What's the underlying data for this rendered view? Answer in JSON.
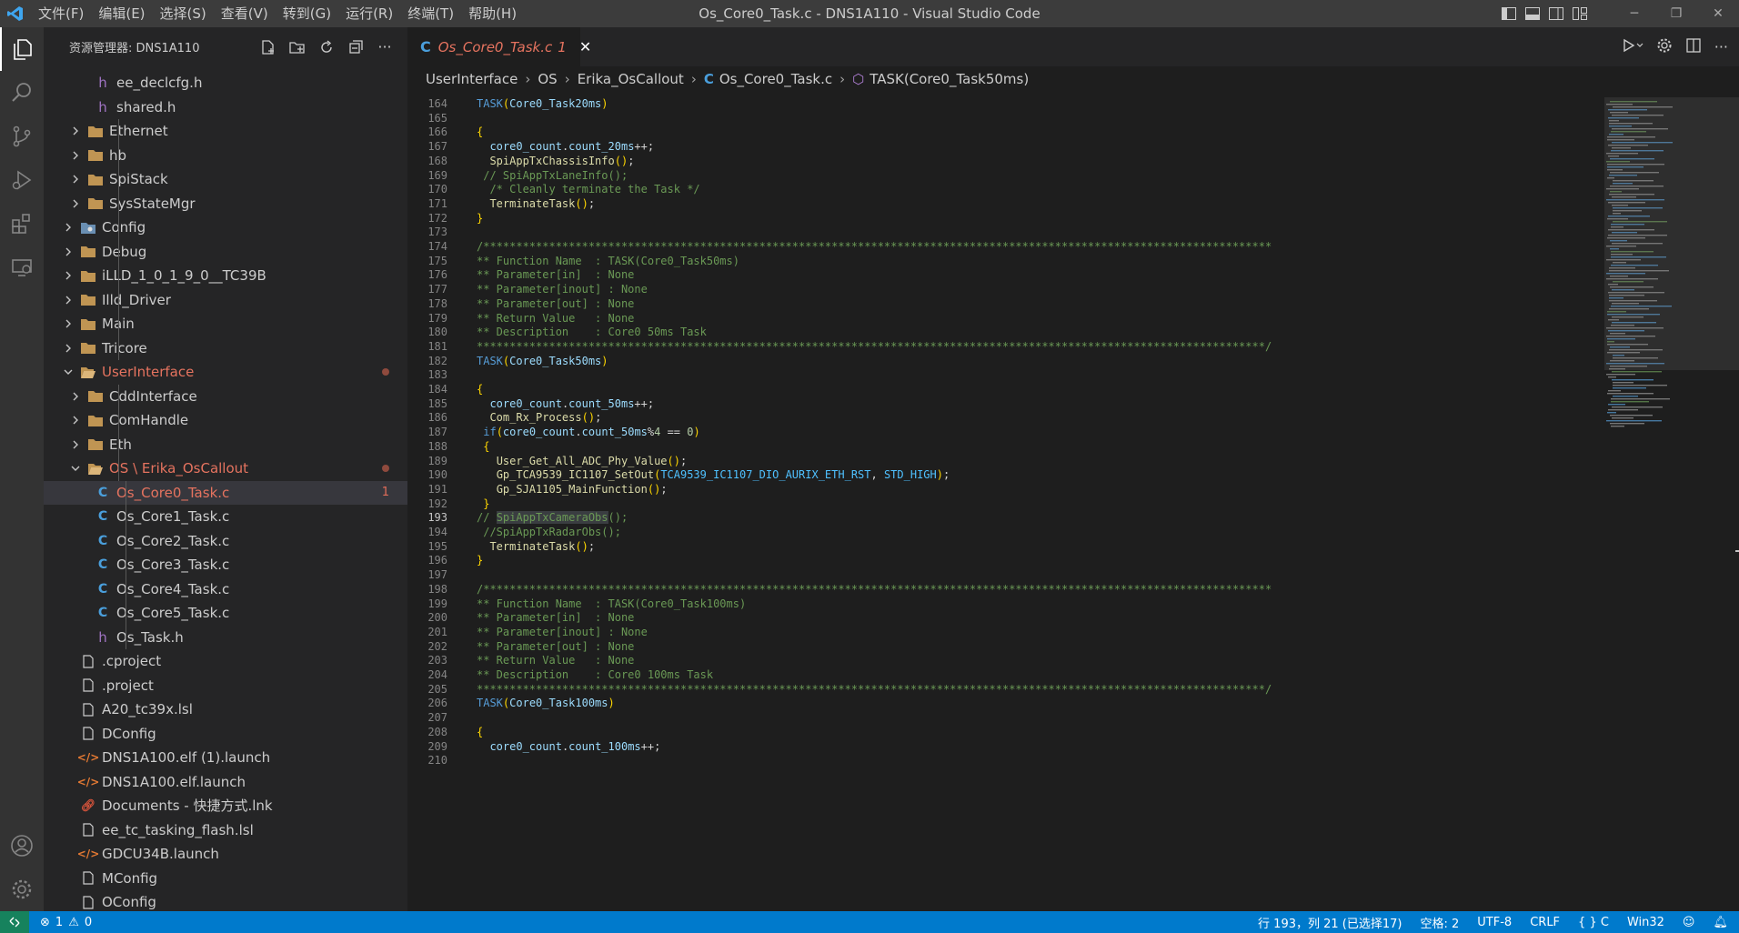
{
  "titlebar": {
    "menus": [
      "文件(F)",
      "编辑(E)",
      "选择(S)",
      "查看(V)",
      "转到(G)",
      "运行(R)",
      "终端(T)",
      "帮助(H)"
    ],
    "window_title": "Os_Core0_Task.c - DNS1A110 - Visual Studio Code"
  },
  "activity": {
    "icons": [
      "explorer-icon",
      "search-icon",
      "source-control-icon",
      "run-debug-icon",
      "extensions-icon",
      "remote-explorer-icon",
      "account-icon",
      "settings-gear-icon"
    ]
  },
  "explorer": {
    "title": "资源管理器: DNS1A110",
    "items": [
      {
        "label": "ee_declcfg.h",
        "kind": "h"
      },
      {
        "label": "shared.h",
        "kind": "h"
      },
      {
        "label": "Ethernet",
        "kind": "folder"
      },
      {
        "label": "hb",
        "kind": "folder"
      },
      {
        "label": "SpiStack",
        "kind": "folder"
      },
      {
        "label": "SysStateMgr",
        "kind": "folder"
      },
      {
        "label": "Config",
        "kind": "folder-config"
      },
      {
        "label": "Debug",
        "kind": "folder"
      },
      {
        "label": "iLLD_1_0_1_9_0__TC39B",
        "kind": "folder"
      },
      {
        "label": "Illd_Driver",
        "kind": "folder"
      },
      {
        "label": "Main",
        "kind": "folder"
      },
      {
        "label": "Tricore",
        "kind": "folder"
      },
      {
        "label": "UserInterface",
        "kind": "folder-open"
      },
      {
        "label": "CddInterface",
        "kind": "folder"
      },
      {
        "label": "ComHandle",
        "kind": "folder"
      },
      {
        "label": "Eth",
        "kind": "folder"
      },
      {
        "label": "OS \\ Erika_OsCallout",
        "kind": "folder-open"
      },
      {
        "label": "Os_Core0_Task.c",
        "kind": "c",
        "badge": "1"
      },
      {
        "label": "Os_Core1_Task.c",
        "kind": "c"
      },
      {
        "label": "Os_Core2_Task.c",
        "kind": "c"
      },
      {
        "label": "Os_Core3_Task.c",
        "kind": "c"
      },
      {
        "label": "Os_Core4_Task.c",
        "kind": "c"
      },
      {
        "label": "Os_Core5_Task.c",
        "kind": "c"
      },
      {
        "label": "Os_Task.h",
        "kind": "h"
      },
      {
        "label": ".cproject",
        "kind": "file"
      },
      {
        "label": ".project",
        "kind": "file"
      },
      {
        "label": "A20_tc39x.lsl",
        "kind": "file"
      },
      {
        "label": "DConfig",
        "kind": "file"
      },
      {
        "label": "DNS1A100.elf (1).launch",
        "kind": "xml"
      },
      {
        "label": "DNS1A100.elf.launch",
        "kind": "xml"
      },
      {
        "label": "Documents - 快捷方式.lnk",
        "kind": "lnk"
      },
      {
        "label": "ee_tc_tasking_flash.lsl",
        "kind": "file"
      },
      {
        "label": "GDCU34B.launch",
        "kind": "xml"
      },
      {
        "label": "MConfig",
        "kind": "file"
      },
      {
        "label": "OConfig",
        "kind": "file"
      }
    ]
  },
  "editor": {
    "tab": {
      "icon": "C",
      "label": "Os_Core0_Task.c",
      "badge": "1",
      "close": "✕"
    },
    "breadcrumb": {
      "parts": [
        "UserInterface",
        "OS",
        "Erika_OsCallout"
      ],
      "file": "Os_Core0_Task.c",
      "symbol": "TASK(Core0_Task50ms)"
    },
    "lines": [
      {
        "n": "164",
        "t": [
          [
            "kw",
            "TASK"
          ],
          [
            "br",
            "("
          ],
          [
            "id",
            "Core0_Task20ms"
          ],
          [
            "br",
            ")"
          ]
        ]
      },
      {
        "n": "165",
        "t": []
      },
      {
        "n": "166",
        "t": [
          [
            "br",
            "{"
          ]
        ]
      },
      {
        "n": "167",
        "t": [
          [
            "pn",
            "  "
          ],
          [
            "id",
            "core0_count"
          ],
          [
            "pn",
            "."
          ],
          [
            "id",
            "count_20ms"
          ],
          [
            "pn",
            "++;"
          ]
        ]
      },
      {
        "n": "168",
        "t": [
          [
            "pn",
            "  "
          ],
          [
            "fn",
            "SpiAppTxChassisInfo"
          ],
          [
            "br",
            "()"
          ],
          [
            "pn",
            ";"
          ]
        ]
      },
      {
        "n": "169",
        "t": [
          [
            "pn",
            " "
          ],
          [
            "cm",
            "// SpiAppTxLaneInfo();"
          ]
        ]
      },
      {
        "n": "170",
        "t": [
          [
            "pn",
            "  "
          ],
          [
            "cm",
            "/* Cleanly terminate the Task */"
          ]
        ]
      },
      {
        "n": "171",
        "t": [
          [
            "pn",
            "  "
          ],
          [
            "fn",
            "TerminateTask"
          ],
          [
            "br",
            "()"
          ],
          [
            "pn",
            ";"
          ]
        ]
      },
      {
        "n": "172",
        "t": [
          [
            "br",
            "}"
          ]
        ]
      },
      {
        "n": "173",
        "t": []
      },
      {
        "n": "174",
        "t": [
          [
            "cm",
            "/************************************************************************************************************************"
          ]
        ]
      },
      {
        "n": "175",
        "t": [
          [
            "cm",
            "** Function Name  : TASK(Core0_Task50ms)"
          ]
        ]
      },
      {
        "n": "176",
        "t": [
          [
            "cm",
            "** Parameter[in]  : None"
          ]
        ]
      },
      {
        "n": "177",
        "t": [
          [
            "cm",
            "** Parameter[inout] : None"
          ]
        ]
      },
      {
        "n": "178",
        "t": [
          [
            "cm",
            "** Parameter[out] : None"
          ]
        ]
      },
      {
        "n": "179",
        "t": [
          [
            "cm",
            "** Return Value   : None"
          ]
        ]
      },
      {
        "n": "180",
        "t": [
          [
            "cm",
            "** Description    : Core0 50ms Task"
          ]
        ]
      },
      {
        "n": "181",
        "t": [
          [
            "cm",
            "************************************************************************************************************************/"
          ]
        ]
      },
      {
        "n": "182",
        "t": [
          [
            "kw",
            "TASK"
          ],
          [
            "br",
            "("
          ],
          [
            "id",
            "Core0_Task50ms"
          ],
          [
            "br",
            ")"
          ]
        ]
      },
      {
        "n": "183",
        "t": []
      },
      {
        "n": "184",
        "t": [
          [
            "br",
            "{"
          ]
        ]
      },
      {
        "n": "185",
        "t": [
          [
            "pn",
            "  "
          ],
          [
            "id",
            "core0_count"
          ],
          [
            "pn",
            "."
          ],
          [
            "id",
            "count_50ms"
          ],
          [
            "pn",
            "++;"
          ]
        ]
      },
      {
        "n": "186",
        "t": [
          [
            "pn",
            "  "
          ],
          [
            "fn",
            "Com_Rx_Process"
          ],
          [
            "br",
            "()"
          ],
          [
            "pn",
            ";"
          ]
        ]
      },
      {
        "n": "187",
        "t": [
          [
            "pn",
            " "
          ],
          [
            "kw",
            "if"
          ],
          [
            "br",
            "("
          ],
          [
            "id",
            "core0_count"
          ],
          [
            "pn",
            "."
          ],
          [
            "id",
            "count_50ms"
          ],
          [
            "pn",
            "%"
          ],
          [
            "nm",
            "4"
          ],
          [
            "pn",
            " == "
          ],
          [
            "nm",
            "0"
          ],
          [
            "br",
            ")"
          ]
        ]
      },
      {
        "n": "188",
        "t": [
          [
            "pn",
            " "
          ],
          [
            "br",
            "{"
          ]
        ]
      },
      {
        "n": "189",
        "t": [
          [
            "pn",
            "   "
          ],
          [
            "fn",
            "User_Get_All_ADC_Phy_Value"
          ],
          [
            "br",
            "()"
          ],
          [
            "pn",
            ";"
          ]
        ]
      },
      {
        "n": "190",
        "t": [
          [
            "pn",
            "   "
          ],
          [
            "fn",
            "Gp_TCA9539_IC1107_SetOut"
          ],
          [
            "br",
            "("
          ],
          [
            "cst",
            "TCA9539_IC1107_DIO_AURIX_ETH_RST"
          ],
          [
            "pn",
            ", "
          ],
          [
            "cst",
            "STD_HIGH"
          ],
          [
            "br",
            ")"
          ],
          [
            "pn",
            ";"
          ]
        ]
      },
      {
        "n": "191",
        "t": [
          [
            "pn",
            "   "
          ],
          [
            "fn",
            "Gp_SJA1105_MainFunction"
          ],
          [
            "br",
            "()"
          ],
          [
            "pn",
            ";"
          ]
        ]
      },
      {
        "n": "192",
        "t": [
          [
            "pn",
            " "
          ],
          [
            "br",
            "}"
          ]
        ]
      },
      {
        "n": "193",
        "t": [
          [
            "cm",
            "// "
          ],
          [
            "hl",
            "SpiAppTxCameraObs"
          ],
          [
            "cm",
            "();"
          ]
        ]
      },
      {
        "n": "194",
        "t": [
          [
            "pn",
            " "
          ],
          [
            "cm",
            "//SpiAppTxRadarObs();"
          ]
        ]
      },
      {
        "n": "195",
        "t": [
          [
            "pn",
            "  "
          ],
          [
            "fn",
            "TerminateTask"
          ],
          [
            "br",
            "()"
          ],
          [
            "pn",
            ";"
          ]
        ]
      },
      {
        "n": "196",
        "t": [
          [
            "br",
            "}"
          ]
        ]
      },
      {
        "n": "197",
        "t": []
      },
      {
        "n": "198",
        "t": [
          [
            "cm",
            "/************************************************************************************************************************"
          ]
        ]
      },
      {
        "n": "199",
        "t": [
          [
            "cm",
            "** Function Name  : TASK(Core0_Task100ms)"
          ]
        ]
      },
      {
        "n": "200",
        "t": [
          [
            "cm",
            "** Parameter[in]  : None"
          ]
        ]
      },
      {
        "n": "201",
        "t": [
          [
            "cm",
            "** Parameter[inout] : None"
          ]
        ]
      },
      {
        "n": "202",
        "t": [
          [
            "cm",
            "** Parameter[out] : None"
          ]
        ]
      },
      {
        "n": "203",
        "t": [
          [
            "cm",
            "** Return Value   : None"
          ]
        ]
      },
      {
        "n": "204",
        "t": [
          [
            "cm",
            "** Description    : Core0 100ms Task"
          ]
        ]
      },
      {
        "n": "205",
        "t": [
          [
            "cm",
            "************************************************************************************************************************/"
          ]
        ]
      },
      {
        "n": "206",
        "t": [
          [
            "kw",
            "TASK"
          ],
          [
            "br",
            "("
          ],
          [
            "id",
            "Core0_Task100ms"
          ],
          [
            "br",
            ")"
          ]
        ]
      },
      {
        "n": "207",
        "t": []
      },
      {
        "n": "208",
        "t": [
          [
            "br",
            "{"
          ]
        ]
      },
      {
        "n": "209",
        "t": [
          [
            "pn",
            "  "
          ],
          [
            "id",
            "core0_count"
          ],
          [
            "pn",
            "."
          ],
          [
            "id",
            "count_100ms"
          ],
          [
            "pn",
            "++;"
          ]
        ]
      },
      {
        "n": "210",
        "t": []
      }
    ],
    "current_line": "193"
  },
  "statusbar": {
    "errors": "1",
    "warnings": "0",
    "position": "行 193，列 21 (已选择17)",
    "indent": "空格: 2",
    "encoding": "UTF-8",
    "eol": "CRLF",
    "language": "C",
    "platform": "Win32"
  },
  "colors": {
    "statusbar": "#007acc",
    "activitybar": "#333333",
    "sidebar": "#252526",
    "editor_bg": "#1e1e1e",
    "modified_file": "#e5735f"
  }
}
